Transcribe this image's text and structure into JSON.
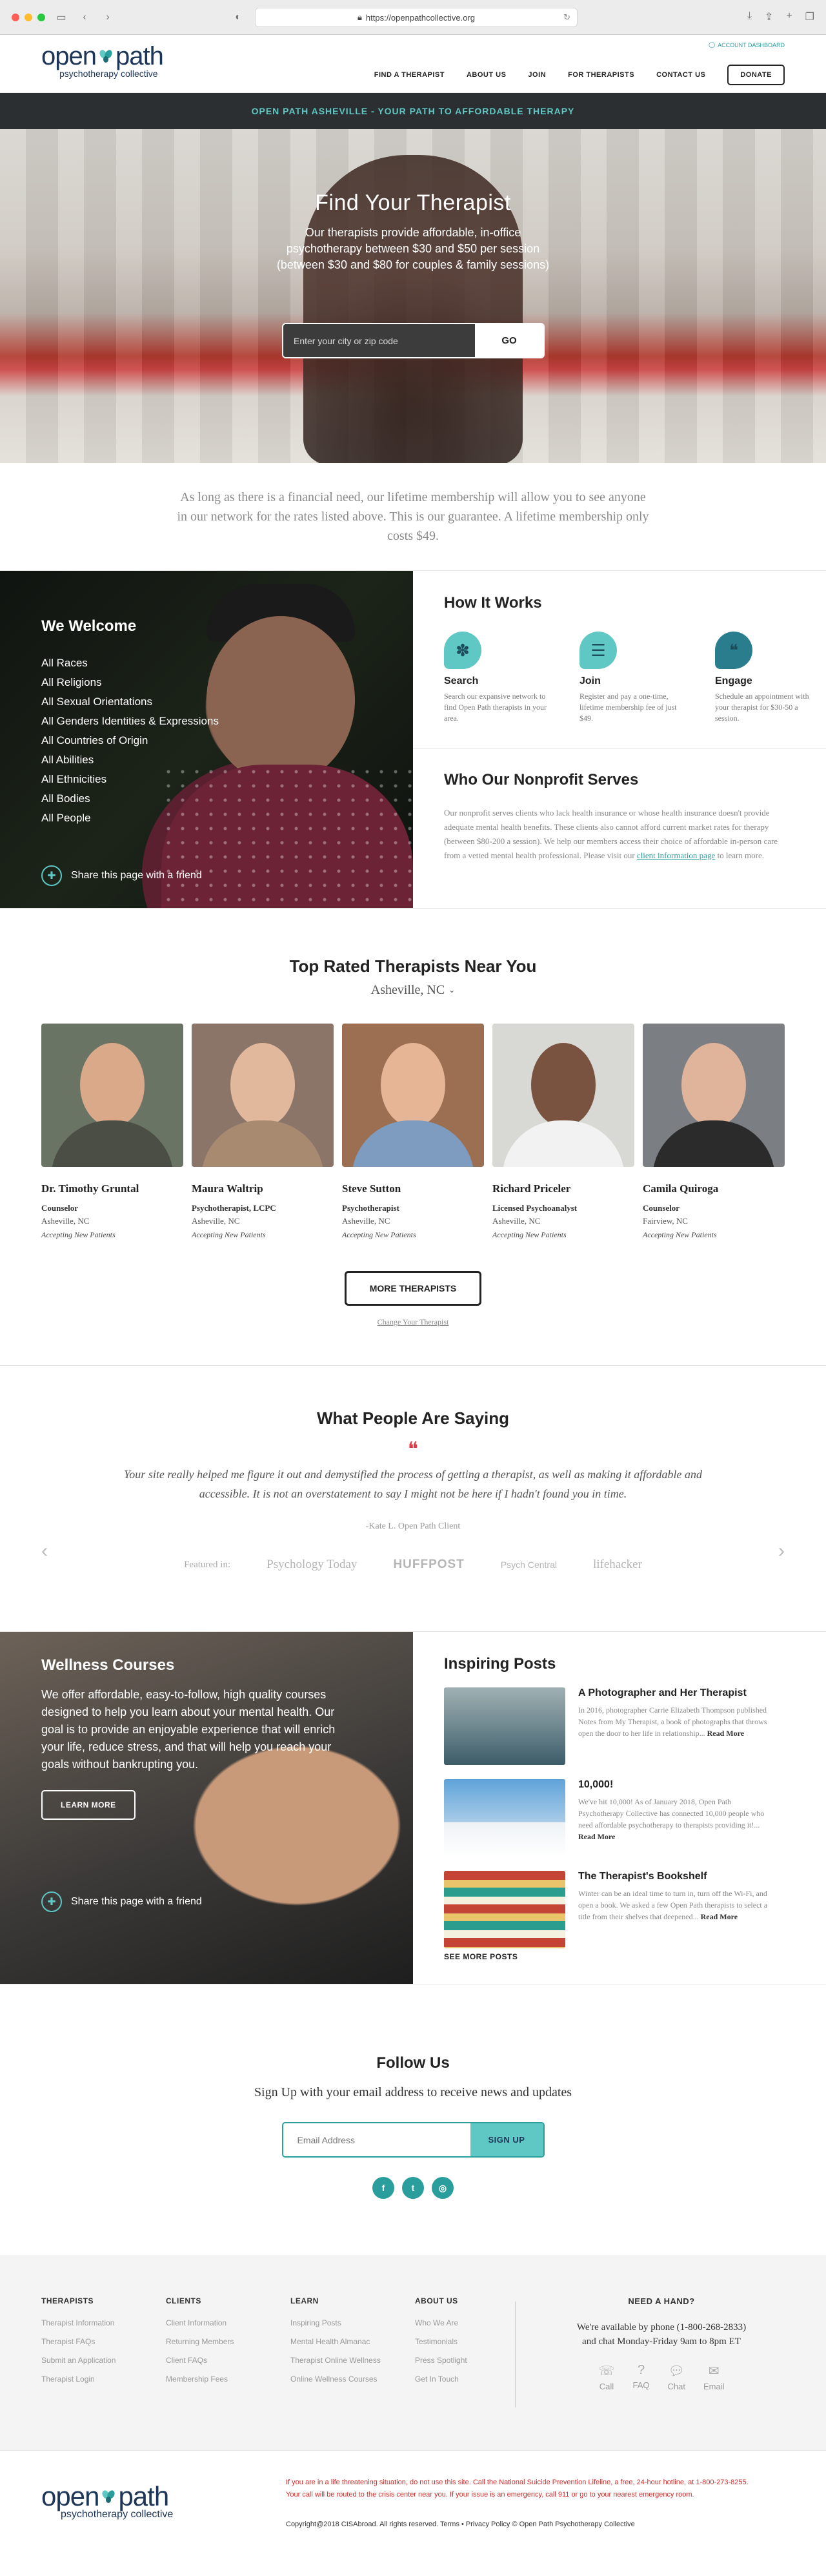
{
  "browser": {
    "url": "https://openpathcollective.org"
  },
  "colors": {
    "teal": "#5fc7c4",
    "dark_teal": "#2a9d9d",
    "navy": "#1d3557",
    "alert_red": "#d62828"
  },
  "header": {
    "logo_word1": "open",
    "logo_word2": "path",
    "logo_sub": "psychotherapy collective",
    "account_label": "ACCOUNT DASHBOARD",
    "nav": [
      {
        "label": "FIND A THERAPIST"
      },
      {
        "label": "ABOUT US"
      },
      {
        "label": "JOIN"
      },
      {
        "label": "FOR THERAPISTS"
      },
      {
        "label": "CONTACT US"
      }
    ],
    "donate_label": "DONATE"
  },
  "banner": {
    "text": "OPEN PATH ASHEVILLE - YOUR PATH TO AFFORDABLE THERAPY"
  },
  "hero": {
    "title": "Find Your Therapist",
    "line1": "Our therapists provide affordable, in-office",
    "line2": "psychotherapy between $30 and $50 per session",
    "line3": "(between $30 and $80 for couples & family sessions)",
    "search_placeholder": "Enter your city or zip code",
    "go_label": "GO"
  },
  "guarantee": {
    "text": "As long as there is a financial need, our lifetime membership will allow you to see anyone in our network for the rates listed above. This is our guarantee. A lifetime membership only costs $49."
  },
  "welcome": {
    "title": "We Welcome",
    "items": [
      "All Races",
      "All Religions",
      "All Sexual Orientations",
      "All Genders Identities & Expressions",
      "All Countries of Origin",
      "All Abilities",
      "All Ethnicities",
      "All Bodies",
      "All People"
    ],
    "share_label": "Share this page with a friend"
  },
  "how": {
    "title": "How It Works",
    "steps": [
      {
        "icon": "search-icon",
        "title": "Search",
        "text": "Search our expansive network to find Open Path therapists in your area."
      },
      {
        "icon": "list-icon",
        "title": "Join",
        "text": "Register and pay a one-time, lifetime membership fee of just $49."
      },
      {
        "icon": "chat-icon",
        "title": "Engage",
        "text": "Schedule an appointment with your therapist for $30-50 a session."
      }
    ]
  },
  "who": {
    "title": "Who Our Nonprofit Serves",
    "text": "Our nonprofit serves clients who lack health insurance or whose health insurance doesn't provide adequate mental health benefits. These clients also cannot afford current market rates for therapy (between $80-200 a session). We help our members access their choice of affordable in-person care from a vetted mental health professional. Please visit our",
    "link": "client information page",
    "tail": "to learn more."
  },
  "therapists": {
    "title": "Top Rated Therapists Near You",
    "location": "Asheville, NC",
    "list": [
      {
        "name": "Dr. Timothy Gruntal",
        "role": "Counselor",
        "city": "Asheville, NC",
        "status": "Accepting New Patients"
      },
      {
        "name": "Maura Waltrip",
        "role": "Psychotherapist, LCPC",
        "city": "Asheville, NC",
        "status": "Accepting New Patients"
      },
      {
        "name": "Steve Sutton",
        "role": "Psychotherapist",
        "city": "Asheville, NC",
        "status": "Accepting New Patients"
      },
      {
        "name": "Richard Priceler",
        "role": "Licensed Psychoanalyst",
        "city": "Asheville, NC",
        "status": "Accepting New Patients"
      },
      {
        "name": "Camila Quiroga",
        "role": "Counselor",
        "city": "Fairview, NC",
        "status": "Accepting New Patients"
      }
    ],
    "more_label": "MORE THERAPISTS",
    "change_label": "Change Your Therapist"
  },
  "testimonials": {
    "title": "What People Are Saying",
    "quote": "Your site really helped me figure it out and demystified the process of getting a therapist, as well as making it affordable and accessible. It is not an overstatement to say I might not be here if I hadn't found you in time.",
    "author": "-Kate L. Open Path Client",
    "featured_label": "Featured in:",
    "featured": [
      "Psychology Today",
      "HUFFPOST",
      "Psych Central",
      "lifehacker"
    ]
  },
  "wellness": {
    "title": "Wellness Courses",
    "text": "We offer affordable, easy-to-follow, high quality courses designed to help you learn about your mental health. Our goal is to provide an enjoyable experience that will enrich your life, reduce stress, and that will help you reach your goals without bankrupting you.",
    "button": "LEARN MORE",
    "share_label": "Share this page with a friend"
  },
  "posts": {
    "title": "Inspiring Posts",
    "items": [
      {
        "title": "A Photographer and Her Therapist",
        "text": "In 2016, photographer Carrie Elizabeth Thompson published Notes from My Therapist, a book of photographs that throws open the door to her life in relationship...",
        "more": "Read More"
      },
      {
        "title": "10,000!",
        "text": "We've hit 10,000! As of January 2018, Open Path Psychotherapy Collective has connected 10,000 people who need affordable psychotherapy to therapists providing it!...",
        "more": "Read More"
      },
      {
        "title": "The Therapist's Bookshelf",
        "text": "Winter can be an ideal time to turn in, turn off the Wi-Fi, and open a book. We asked a few Open Path therapists to select a title from their shelves that deepened...",
        "more": "Read More"
      }
    ],
    "see_more": "SEE MORE POSTS"
  },
  "follow": {
    "title": "Follow Us",
    "subtitle": "Sign Up with your email address to receive news and updates",
    "placeholder": "Email Address",
    "button": "SIGN UP",
    "socials": [
      "f",
      "t",
      "◎"
    ]
  },
  "footer": {
    "cols": [
      {
        "title": "THERAPISTS",
        "links": [
          "Therapist Information",
          "Therapist FAQs",
          "Submit an Application",
          "Therapist Login"
        ]
      },
      {
        "title": "CLIENTS",
        "links": [
          "Client Information",
          "Returning Members",
          "Client FAQs",
          "Membership Fees"
        ]
      },
      {
        "title": "LEARN",
        "links": [
          "Inspiring Posts",
          "Mental Health Almanac",
          "Therapist Online Wellness",
          "Online Wellness Courses"
        ]
      },
      {
        "title": "ABOUT US",
        "links": [
          "Who We Are",
          "Testimonials",
          "Press Spotlight",
          "Get In Touch"
        ]
      }
    ],
    "help_title": "NEED A HAND?",
    "help_line1": "We're available by phone (1-800-268-2833)",
    "help_line2": "and chat Monday-Friday 9am to 8pm ET",
    "help_icons": [
      {
        "icon": "phone-icon",
        "label": "Call"
      },
      {
        "icon": "question-icon",
        "label": "FAQ"
      },
      {
        "icon": "chat-icon",
        "label": "Chat"
      },
      {
        "icon": "mail-icon",
        "label": "Email"
      }
    ],
    "legal": "If you are in a life threatening situation, do not use this site. Call the National Suicide Prevention Lifeline, a free, 24-hour hotline, at 1-800-273-8255. Your call will be routed to the crisis center near you. If your issue is an emergency, call 911 or go to your nearest emergency room.",
    "copyright": "Copyright@2018 CISAbroad. All rights reserved.  Terms • Privacy Policy © Open Path Psychotherapy Collective"
  }
}
